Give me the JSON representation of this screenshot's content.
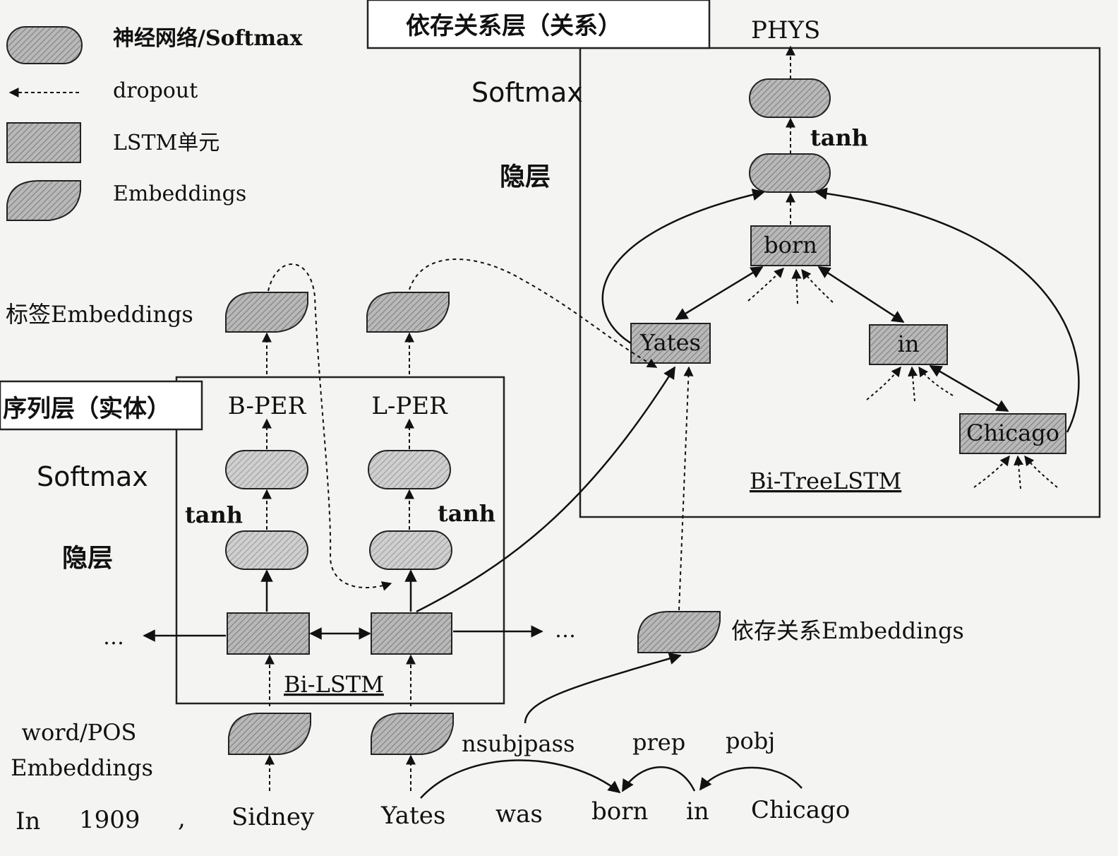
{
  "legend": {
    "nn": "神经网络/Softmax",
    "dropout": "dropout",
    "lstm": "LSTM单元",
    "emb": "Embeddings"
  },
  "relation_box": {
    "title": "依存关系层（关系）",
    "output": "PHYS",
    "softmax": "Softmax",
    "tanh": "tanh",
    "hidden": "隐层",
    "nodes": {
      "born": "born",
      "yates": "Yates",
      "in": "in",
      "chicago": "Chicago"
    },
    "bottom": "Bi-TreeLSTM"
  },
  "entity_box": {
    "title": "序列层（实体）",
    "softmax": "Softmax",
    "hidden": "隐层",
    "tag1": "B-PER",
    "tag2": "L-PER",
    "tanh1": "tanh",
    "tanh2": "tanh",
    "bottom": "Bi-LSTM",
    "dots_left": "…",
    "dots_right": "…"
  },
  "labels": {
    "tag_embeddings": "标签Embeddings",
    "dep_embeddings": "依存关系Embeddings",
    "wordpos_1": "word/POS",
    "wordpos_2": "Embeddings"
  },
  "dependencies": [
    "nsubjpass",
    "prep",
    "pobj"
  ],
  "sentence": [
    "In",
    "1909",
    ",",
    "Sidney",
    "Yates",
    "was",
    "born",
    "in",
    "Chicago"
  ]
}
